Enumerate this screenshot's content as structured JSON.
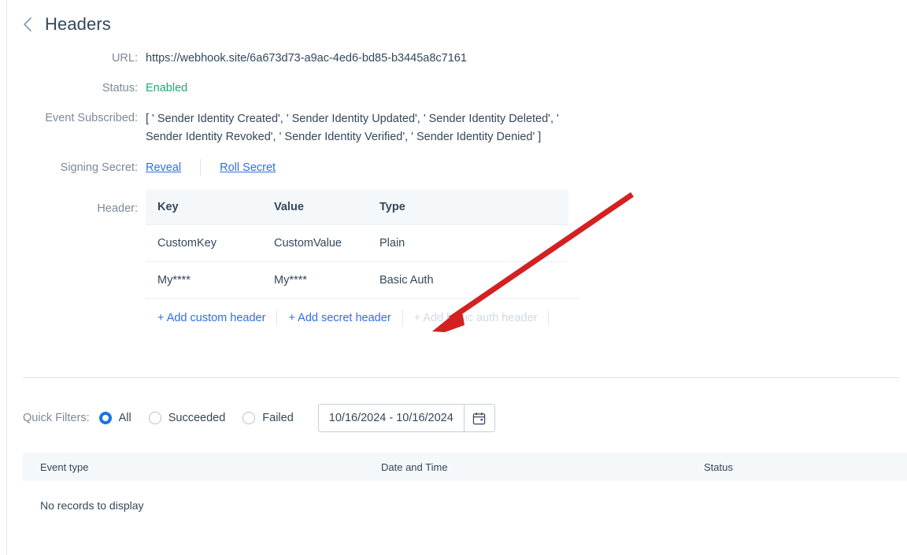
{
  "header": {
    "back_icon": "chevron-left-icon",
    "title": "Headers"
  },
  "details": {
    "url_label": "URL:",
    "url_value": "https://webhook.site/6a673d73-a9ac-4ed6-bd85-b3445a8c7161",
    "status_label": "Status:",
    "status_value": "Enabled",
    "events_label": "Event Subscribed:",
    "events_value": "[ ' Sender Identity Created', ' Sender Identity Updated', ' Sender Identity Deleted', ' Sender Identity Revoked', ' Sender Identity Verified', ' Sender Identity Denied' ]",
    "signing_secret_label": "Signing Secret:",
    "reveal_link": "Reveal",
    "roll_secret_link": "Roll Secret",
    "header_label": "Header:"
  },
  "headers_table": {
    "columns": [
      "Key",
      "Value",
      "Type"
    ],
    "rows": [
      {
        "key": "CustomKey",
        "value": "CustomValue",
        "type": "Plain"
      },
      {
        "key": "My****",
        "value": "My****",
        "type": "Basic Auth"
      }
    ],
    "actions": [
      {
        "label": "+ Add custom header",
        "disabled": false
      },
      {
        "label": "+ Add secret header",
        "disabled": false
      },
      {
        "label": "+ Add basic auth header",
        "disabled": true
      }
    ]
  },
  "quick_filters": {
    "label": "Quick Filters:",
    "options": [
      {
        "label": "All",
        "selected": true
      },
      {
        "label": "Succeeded",
        "selected": false
      },
      {
        "label": "Failed",
        "selected": false
      }
    ],
    "date_range_value": "10/16/2024 - 10/16/2024",
    "calendar_icon": "calendar-icon"
  },
  "events_table": {
    "columns": [
      "Event type",
      "Date and Time",
      "Status"
    ],
    "empty_message": "No records to display"
  },
  "colors": {
    "link": "#2f6fe4",
    "success": "#1faa71",
    "radio_selected": "#1a73e8",
    "table_head_bg": "#f5f8fa",
    "annotation": "#d32121",
    "text": "#33475b",
    "muted": "#7c8a99",
    "disabled": "#cfd9e4"
  }
}
